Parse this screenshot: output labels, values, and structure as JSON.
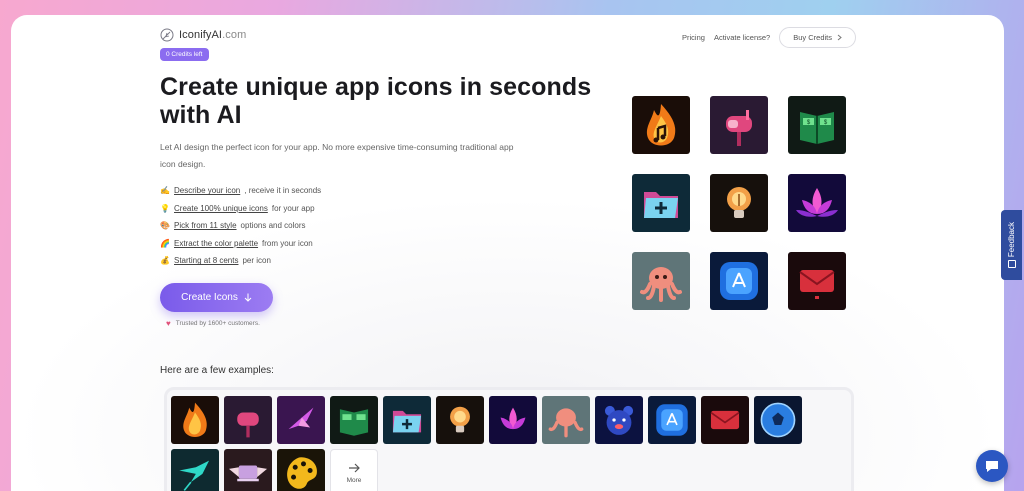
{
  "brand": {
    "name": "IconifyAI",
    "suffix": ".com",
    "credits_badge": "0 Credits left"
  },
  "nav": {
    "pricing": "Pricing",
    "activate": "Activate license?",
    "buy": "Buy Credits"
  },
  "hero": {
    "title": "Create unique app icons in seconds with AI",
    "description": "Let AI design the perfect icon for your app. No more expensive time-consuming traditional app icon design."
  },
  "features": [
    {
      "emoji": "✍",
      "link": "Describe your icon",
      "rest": ", receive it in seconds"
    },
    {
      "emoji": "💡",
      "link": "Create 100% unique icons",
      "rest": " for your app"
    },
    {
      "emoji": "🎨",
      "link": "Pick from 11 style",
      "rest": " options and colors"
    },
    {
      "emoji": "🌈",
      "link": "Extract the color palette",
      "rest": " from your icon"
    },
    {
      "emoji": "💰",
      "link": "Starting at 8 cents",
      "rest": " per icon"
    }
  ],
  "cta": {
    "label": "Create Icons",
    "trusted": "Trusted by 1600+ customers."
  },
  "showcase_icons": [
    "music-flame-icon",
    "mailbox-icon",
    "money-book-icon",
    "folder-plus-icon",
    "lightbulb-icon",
    "lotus-icon",
    "octopus-icon",
    "app-store-icon",
    "envelope-icon"
  ],
  "examples": {
    "title": "Here are a few examples:",
    "icons": [
      "music-flame-icon",
      "mailbox-icon",
      "hummingbird-icon",
      "money-book-icon",
      "folder-plus-icon",
      "lightbulb-icon",
      "lotus-icon",
      "octopus-icon",
      "bear-icon",
      "app-store-icon",
      "envelope-icon",
      "soccer-ball-icon",
      "teal-bird-icon",
      "winged-laptop-icon",
      "palette-icon"
    ],
    "more_label": "More"
  },
  "feedback": {
    "label": "Feedback"
  },
  "colors": {
    "accent": "#8b6cf0",
    "feedback": "#2f4c9e",
    "chat": "#2b57c2"
  }
}
